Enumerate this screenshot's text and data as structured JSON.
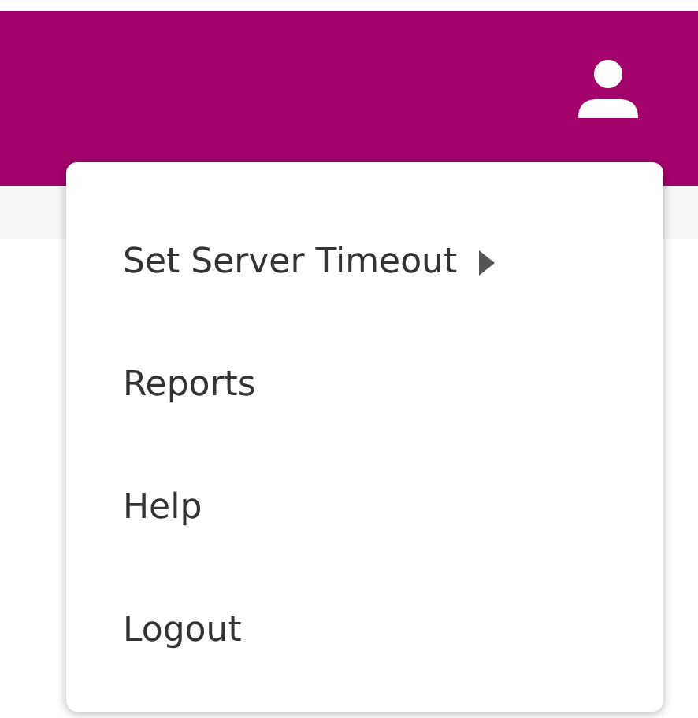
{
  "menu": {
    "items": [
      {
        "label": "Set Server Timeout",
        "has_submenu": true
      },
      {
        "label": "Reports",
        "has_submenu": false
      },
      {
        "label": "Help",
        "has_submenu": false
      },
      {
        "label": "Logout",
        "has_submenu": false
      }
    ]
  }
}
